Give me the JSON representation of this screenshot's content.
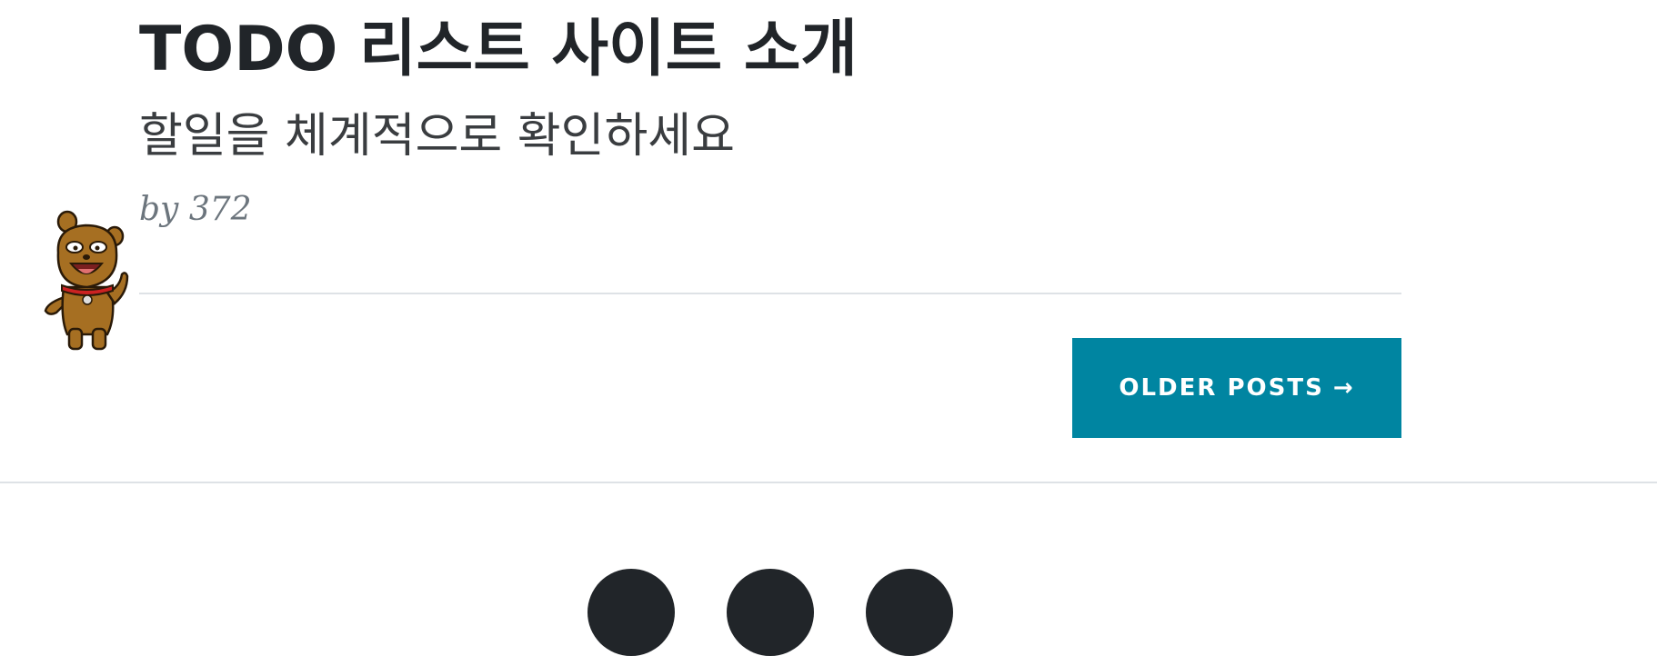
{
  "post": {
    "title": "TODO 리스트 사이트 소개",
    "subtitle": "할일을 체계적으로 확인하세요",
    "meta": "by 372"
  },
  "pager": {
    "older_label": "Older Posts",
    "arrow": "→"
  },
  "mascot": {
    "icon": "brown-dog-mascot-icon"
  },
  "footer": {
    "social_icons": [
      "social-icon-1",
      "social-icon-2",
      "social-icon-3"
    ]
  },
  "colors": {
    "accent": "#0085a1",
    "text": "#212529",
    "meta": "#6c757d",
    "divider": "#dee2e6"
  }
}
